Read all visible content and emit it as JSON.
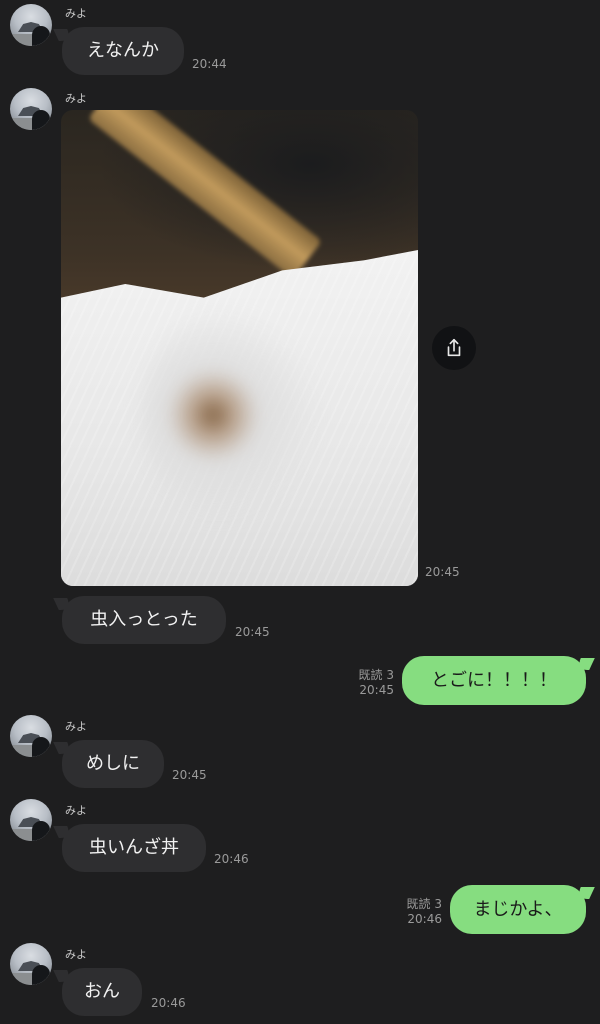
{
  "sender_name": "みよ",
  "messages": [
    {
      "text": "えなんか",
      "time": "20:44"
    },
    {
      "time": "20:45"
    },
    {
      "text": "虫入っとった",
      "time": "20:45"
    },
    {
      "text": "とごに！！！！",
      "read": "既読 3",
      "time": "20:45"
    },
    {
      "text": "めしに",
      "time": "20:45"
    },
    {
      "text": "虫いんざ丼",
      "time": "20:46"
    },
    {
      "text": "まじかよ、",
      "read": "既読 3",
      "time": "20:46"
    },
    {
      "text": "おん",
      "time": "20:46"
    }
  ],
  "icons": {
    "share": "share-icon"
  },
  "colors": {
    "background": "#1e1e1f",
    "incoming_bubble": "#2e2e30",
    "outgoing_bubble": "#86dd80"
  }
}
